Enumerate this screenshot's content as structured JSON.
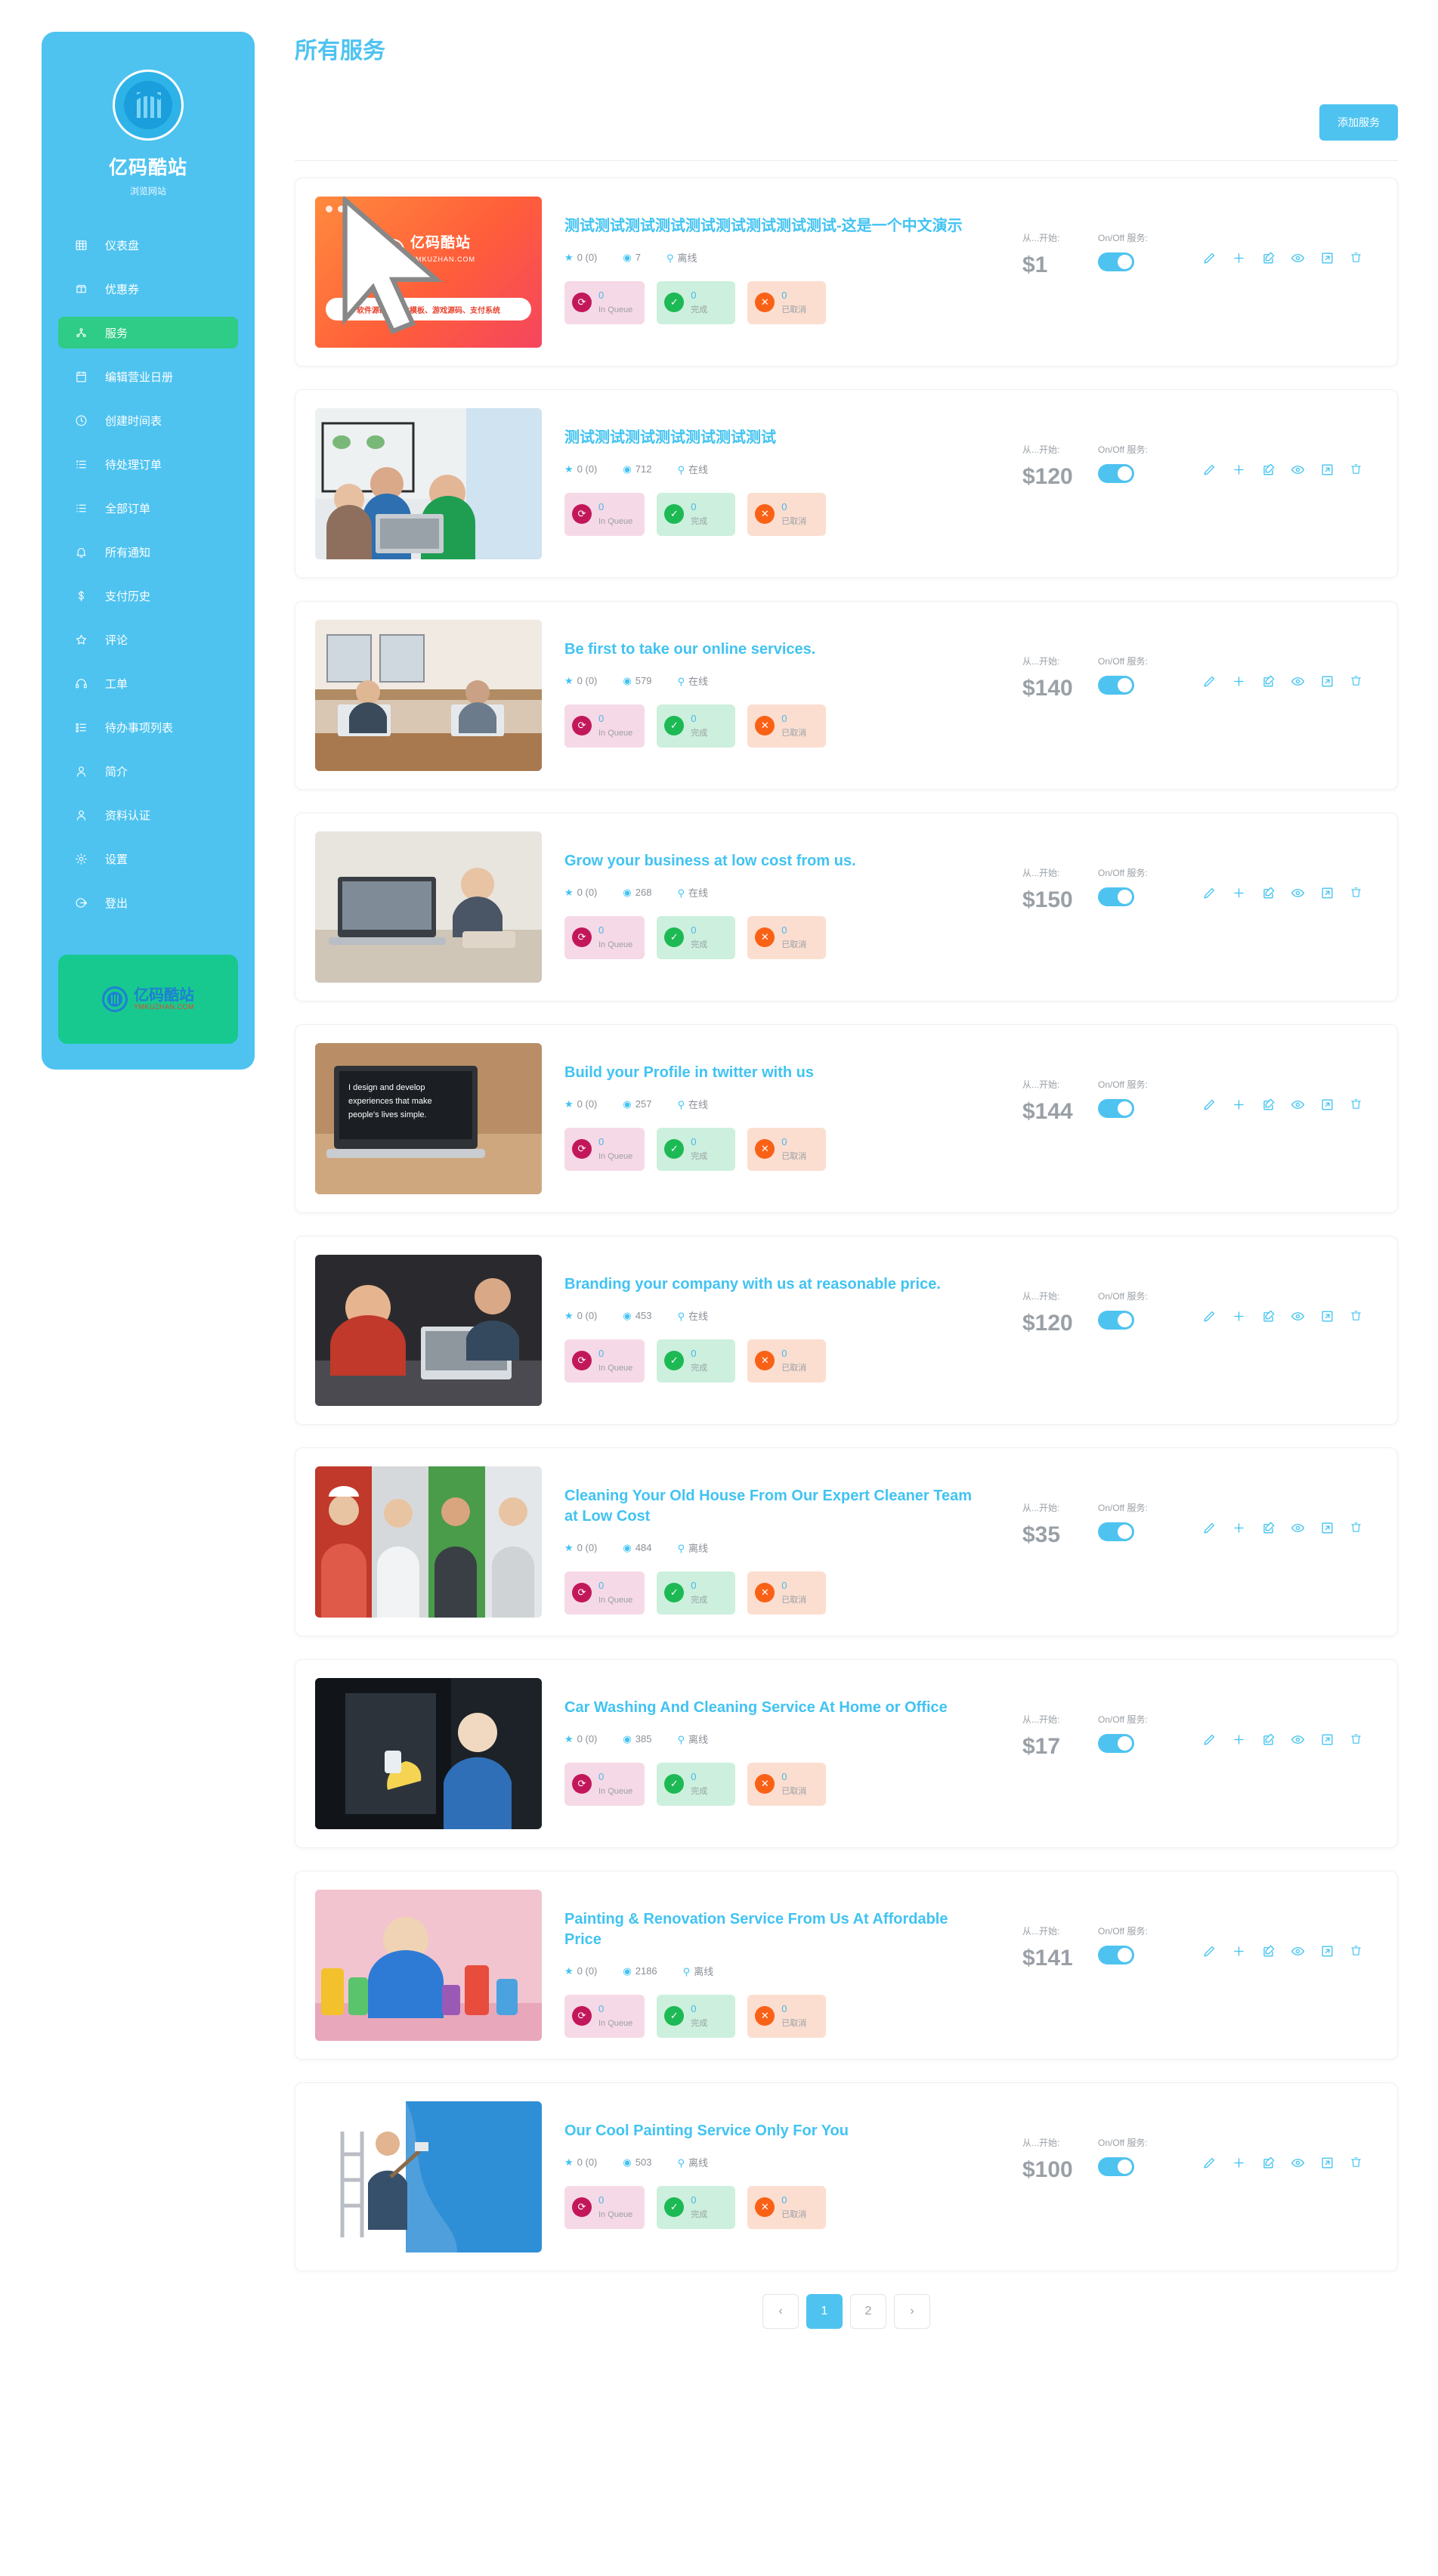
{
  "sidebar": {
    "brand_name": "亿码酷站",
    "brand_sub": "浏览网站",
    "items": [
      {
        "label": "仪表盘",
        "icon": "dashboard-icon",
        "active": false
      },
      {
        "label": "优惠券",
        "icon": "coupon-icon",
        "active": false
      },
      {
        "label": "服务",
        "icon": "services-icon",
        "active": true
      },
      {
        "label": "编辑营业日册",
        "icon": "calendar-icon",
        "active": false
      },
      {
        "label": "创建时间表",
        "icon": "clock-icon",
        "active": false
      },
      {
        "label": "待处理订单",
        "icon": "pending-list-icon",
        "active": false
      },
      {
        "label": "全部订单",
        "icon": "list-icon",
        "active": false
      },
      {
        "label": "所有通知",
        "icon": "bell-icon",
        "active": false
      },
      {
        "label": "支付历史",
        "icon": "dollar-icon",
        "active": false
      },
      {
        "label": "评论",
        "icon": "star-icon",
        "active": false
      },
      {
        "label": "工单",
        "icon": "headset-icon",
        "active": false
      },
      {
        "label": "待办事项列表",
        "icon": "todo-list-icon",
        "active": false
      },
      {
        "label": "简介",
        "icon": "user-icon",
        "active": false
      },
      {
        "label": "资料认证",
        "icon": "user-verify-icon",
        "active": false
      },
      {
        "label": "设置",
        "icon": "gear-icon",
        "active": false
      },
      {
        "label": "登出",
        "icon": "logout-icon",
        "active": false
      }
    ],
    "promo": {
      "cn": "亿码酷站",
      "en": "YMKUZHAN.COM"
    }
  },
  "header": {
    "page_title": "所有服务",
    "add_button": "添加服务"
  },
  "labels": {
    "price_head": "从...开始:",
    "toggle_head": "On/Off 服务:",
    "queue": "In Queue",
    "done": "完成",
    "cancel": "已取消",
    "online": "在线",
    "offline": "离线"
  },
  "actions": [
    {
      "name": "edit-pencil-icon",
      "title": "编辑"
    },
    {
      "name": "plus-icon",
      "title": "添加"
    },
    {
      "name": "edit-square-icon",
      "title": "修改"
    },
    {
      "name": "eye-icon",
      "title": "预览"
    },
    {
      "name": "external-link-icon",
      "title": "打开"
    },
    {
      "name": "trash-icon",
      "title": "删除"
    }
  ],
  "colors": {
    "brand_blue": "#4ec3f0",
    "active_green": "#2ecc86",
    "queue_pink": "#c2185b",
    "done_green": "#1db954",
    "cancel_orange": "#f96216",
    "muted": "#9aa0a6"
  },
  "services": [
    {
      "title": "测试测试测试测试测试测试测试测试测试-这是一个中文演示",
      "rating": "0 (0)",
      "views": "7",
      "status": "离线",
      "queue": "0",
      "done": "0",
      "cancel": "0",
      "price": "$1",
      "thumb": "promo",
      "on": true
    },
    {
      "title": "测试测试测试测试测试测试测试",
      "rating": "0 (0)",
      "views": "712",
      "status": "在线",
      "queue": "0",
      "done": "0",
      "cancel": "0",
      "price": "$120",
      "thumb": "team",
      "on": true
    },
    {
      "title": "Be first to take our online services.",
      "rating": "0 (0)",
      "views": "579",
      "status": "在线",
      "queue": "0",
      "done": "0",
      "cancel": "0",
      "price": "$140",
      "thumb": "office",
      "on": true
    },
    {
      "title": "Grow your business at low cost from us.",
      "rating": "0 (0)",
      "views": "268",
      "status": "在线",
      "queue": "0",
      "done": "0",
      "cancel": "0",
      "price": "$150",
      "thumb": "laptop",
      "on": true
    },
    {
      "title": "Build your Profile in twitter with us",
      "rating": "0 (0)",
      "views": "257",
      "status": "在线",
      "queue": "0",
      "done": "0",
      "cancel": "0",
      "price": "$144",
      "thumb": "macbook",
      "on": true
    },
    {
      "title": "Branding your company with us at reasonable price.",
      "rating": "0 (0)",
      "views": "453",
      "status": "在线",
      "queue": "0",
      "done": "0",
      "cancel": "0",
      "price": "$120",
      "thumb": "branding",
      "on": true
    },
    {
      "title": "Cleaning Your Old House From Our Expert Cleaner Team at Low Cost",
      "rating": "0 (0)",
      "views": "484",
      "status": "离线",
      "queue": "0",
      "done": "0",
      "cancel": "0",
      "price": "$35",
      "thumb": "cleaners",
      "on": true
    },
    {
      "title": "Car Washing And Cleaning Service At Home or Office",
      "rating": "0 (0)",
      "views": "385",
      "status": "离线",
      "queue": "0",
      "done": "0",
      "cancel": "0",
      "price": "$17",
      "thumb": "carwash",
      "on": true
    },
    {
      "title": "Painting & Renovation Service From Us At Affordable Price",
      "rating": "0 (0)",
      "views": "2186",
      "status": "离线",
      "queue": "0",
      "done": "0",
      "cancel": "0",
      "price": "$141",
      "thumb": "painting",
      "on": true
    },
    {
      "title": "Our Cool Painting Service Only For You",
      "rating": "0 (0)",
      "views": "503",
      "status": "离线",
      "queue": "0",
      "done": "0",
      "cancel": "0",
      "price": "$100",
      "thumb": "wallpaint",
      "on": true
    }
  ],
  "pagination": {
    "prev": "‹",
    "next": "›",
    "pages": [
      "1",
      "2"
    ],
    "current": "1"
  }
}
